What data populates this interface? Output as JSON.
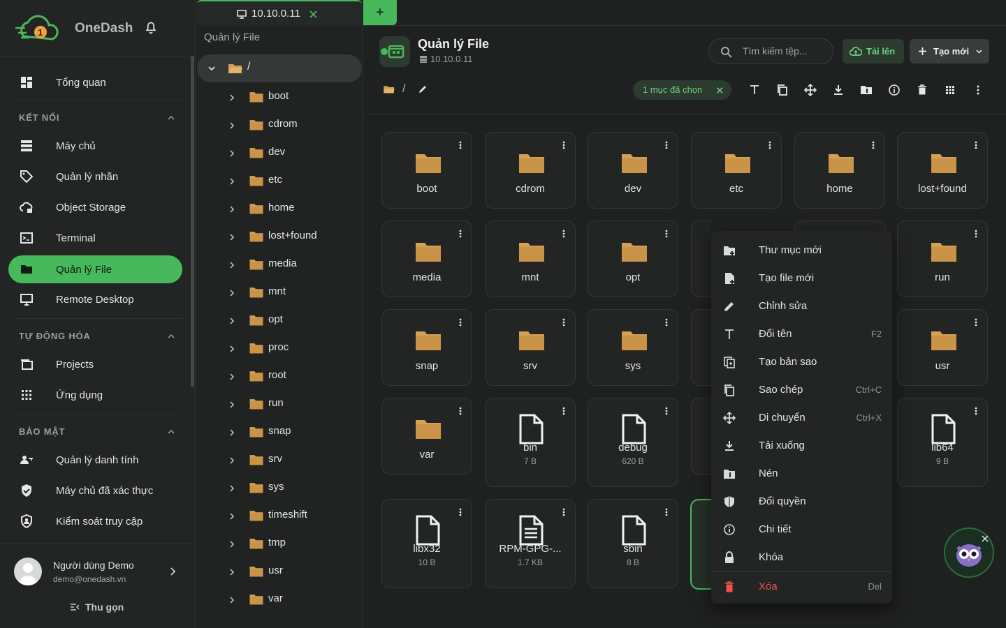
{
  "app": {
    "name": "OneDash"
  },
  "sidebar": {
    "overview": "Tổng quan",
    "sections": {
      "connect": "KẾT NỐI",
      "automation": "TỰ ĐỘNG HÓA",
      "security": "BẢO MẬT"
    },
    "items": [
      {
        "label": "Máy chủ"
      },
      {
        "label": "Quản lý nhãn"
      },
      {
        "label": "Object Storage"
      },
      {
        "label": "Terminal"
      },
      {
        "label": "Quản lý File"
      },
      {
        "label": "Remote Desktop"
      },
      {
        "label": "Projects"
      },
      {
        "label": "Ứng dụng"
      },
      {
        "label": "Quản lý danh tính"
      },
      {
        "label": "Máy chủ đã xác thực"
      },
      {
        "label": "Kiểm soát truy cập"
      }
    ],
    "user": {
      "name": "Người dùng Demo",
      "email": "demo@onedash.vn"
    },
    "collapse": "Thu gọn"
  },
  "tab": {
    "label": "10.10.0.11",
    "add": "+"
  },
  "tree": {
    "title": "Quản lý File",
    "root": "/",
    "items": [
      "boot",
      "cdrom",
      "dev",
      "etc",
      "home",
      "lost+found",
      "media",
      "mnt",
      "opt",
      "proc",
      "root",
      "run",
      "snap",
      "srv",
      "sys",
      "timeshift",
      "tmp",
      "usr",
      "var"
    ]
  },
  "header": {
    "title": "Quản lý File",
    "host": "10.10.0.11",
    "search_placeholder": "Tìm kiếm tệp...",
    "upload": "Tải lên",
    "create": "Tạo mới"
  },
  "path": {
    "sep": "/"
  },
  "selection": {
    "label": "1 mục đã chọn"
  },
  "grid": [
    {
      "name": "boot",
      "kind": "folder"
    },
    {
      "name": "cdrom",
      "kind": "folder"
    },
    {
      "name": "dev",
      "kind": "folder"
    },
    {
      "name": "etc",
      "kind": "folder"
    },
    {
      "name": "home",
      "kind": "folder"
    },
    {
      "name": "lost+found",
      "kind": "folder"
    },
    {
      "name": "media",
      "kind": "folder"
    },
    {
      "name": "mnt",
      "kind": "folder"
    },
    {
      "name": "opt",
      "kind": "folder"
    },
    {
      "name": "run",
      "kind": "folder"
    },
    {
      "name": "snap",
      "kind": "folder"
    },
    {
      "name": "srv",
      "kind": "folder"
    },
    {
      "name": "sys",
      "kind": "folder"
    },
    {
      "name": "usr",
      "kind": "folder"
    },
    {
      "name": "var",
      "kind": "folder"
    },
    {
      "name": "bin",
      "kind": "file",
      "size": "7 B"
    },
    {
      "name": "debug",
      "kind": "file",
      "size": "620 B"
    },
    {
      "name": "lib64",
      "kind": "file",
      "size": "9 B"
    },
    {
      "name": "libx32",
      "kind": "file",
      "size": "10 B"
    },
    {
      "name": "RPM-GPG-...",
      "kind": "doc",
      "size": "1.7 KB"
    },
    {
      "name": "sbin",
      "kind": "file",
      "size": "8 B"
    }
  ],
  "context_menu": [
    {
      "label": "Thư mục mới",
      "icon": "new-folder-icon",
      "shortcut": ""
    },
    {
      "label": "Tạo file mới",
      "icon": "new-file-icon",
      "shortcut": ""
    },
    {
      "label": "Chỉnh sửa",
      "icon": "pencil-icon",
      "shortcut": ""
    },
    {
      "label": "Đổi tên",
      "icon": "text-icon",
      "shortcut": "F2"
    },
    {
      "label": "Tạo bản sao",
      "icon": "duplicate-icon",
      "shortcut": ""
    },
    {
      "label": "Sao chép",
      "icon": "copy-icon",
      "shortcut": "Ctrl+C"
    },
    {
      "label": "Di chuyển",
      "icon": "move-icon",
      "shortcut": "Ctrl+X"
    },
    {
      "label": "Tải xuống",
      "icon": "download-icon",
      "shortcut": ""
    },
    {
      "label": "Nén",
      "icon": "archive-icon",
      "shortcut": ""
    },
    {
      "label": "Đổi quyền",
      "icon": "shield-icon",
      "shortcut": ""
    },
    {
      "label": "Chi tiết",
      "icon": "info-icon",
      "shortcut": ""
    },
    {
      "label": "Khóa",
      "icon": "lock-icon",
      "shortcut": ""
    },
    {
      "label": "Xóa",
      "icon": "trash-icon",
      "shortcut": "Del"
    }
  ],
  "colors": {
    "accent": "#48b85c",
    "folder": "#d4a056",
    "danger": "#f0514a",
    "bg": "#1f2120"
  }
}
